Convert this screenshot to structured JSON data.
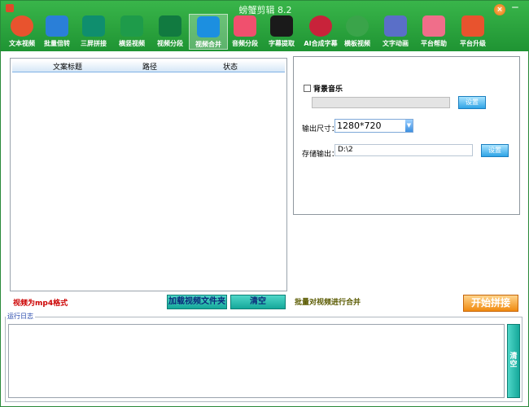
{
  "window": {
    "title": "螃蟹剪辑 8.2"
  },
  "colors": {
    "brand_green": "#1f9433",
    "accent_orange": "#f08a10",
    "note_red": "#cc0000"
  },
  "toolbar": {
    "items": [
      {
        "label": "文本视频",
        "icon": "basketball-icon",
        "color": "#e8532e"
      },
      {
        "label": "批量倍转",
        "icon": "refresh-icon",
        "color": "#2a7fd8"
      },
      {
        "label": "三屏拼接",
        "icon": "split-screen-icon",
        "color": "#0f8e6e"
      },
      {
        "label": "横竖视频",
        "icon": "tv-icon",
        "color": "#1e9b4a"
      },
      {
        "label": "视频分段",
        "icon": "cut-icon",
        "color": "#117a40"
      },
      {
        "label": "视频合并",
        "icon": "video-merge-icon",
        "color": "#1c8fe0"
      },
      {
        "label": "音频分段",
        "icon": "music-icon",
        "color": "#f0506e"
      },
      {
        "label": "字幕提取",
        "icon": "text-icon",
        "color": "#1a1a1a"
      },
      {
        "label": "AI合成字幕",
        "icon": "audio-wave-icon",
        "color": "#c8233a"
      },
      {
        "label": "横板视频",
        "icon": "template-icon",
        "color": "#3aa44a"
      },
      {
        "label": "文字动画",
        "icon": "film-icon",
        "color": "#5a6fc8"
      },
      {
        "label": "平台帮助",
        "icon": "grid-icon",
        "color": "#f06e8a"
      },
      {
        "label": "平台升级",
        "icon": "rocket-icon",
        "color": "#e8532e"
      }
    ]
  },
  "list": {
    "columns": [
      "文案标题",
      "路径",
      "状态"
    ]
  },
  "left_note": "视频为mp4格式",
  "buttons": {
    "load_folder": "加载视频文件夹",
    "clear_list": "清空",
    "start": "开始拼接",
    "clear_log": "清空"
  },
  "settings": {
    "bgm_label": "背景音乐",
    "bgm_browse": "设置",
    "size_label": "输出尺寸：",
    "size_value": "1280*720",
    "store_label": "存储输出：",
    "store_value": "D:\\2",
    "store_browse": "设置"
  },
  "batch_text": "批量对视频进行合并",
  "log": {
    "legend": "运行日志"
  }
}
